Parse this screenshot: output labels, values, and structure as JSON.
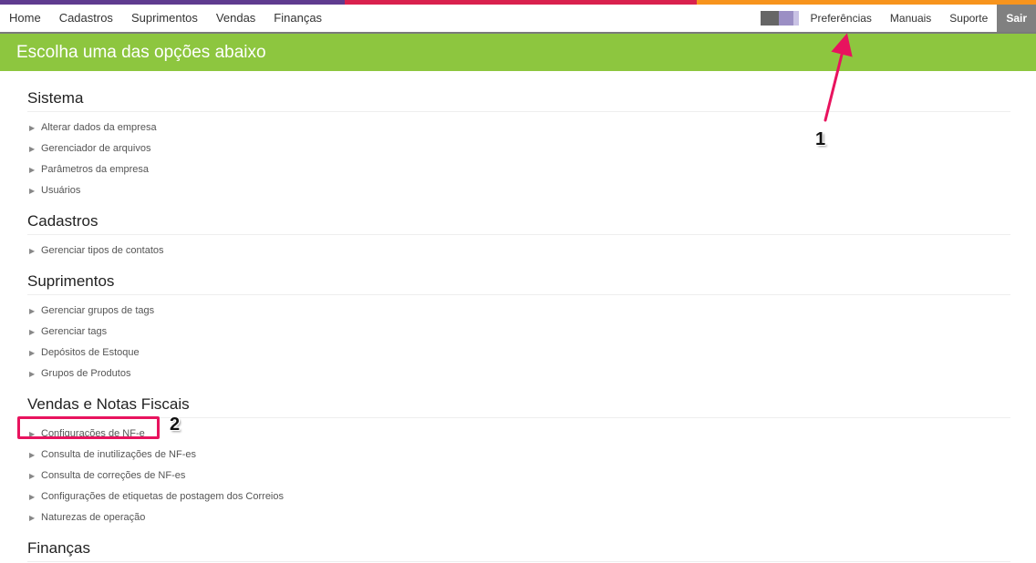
{
  "colors": {
    "stripe": [
      "#5f3b8f",
      "#d9214e",
      "#f7941d"
    ],
    "banner": "#8dc63f",
    "annotation": "#e8135e",
    "swatch": [
      "#666666",
      "#9b8fc4",
      "#c9c2e4"
    ]
  },
  "nav": {
    "left": [
      "Home",
      "Cadastros",
      "Suprimentos",
      "Vendas",
      "Finanças"
    ],
    "right": [
      "Preferências",
      "Manuais",
      "Suporte"
    ],
    "logout": "Sair"
  },
  "banner": {
    "title": "Escolha uma das opções abaixo"
  },
  "sections": [
    {
      "title": "Sistema",
      "items": [
        "Alterar dados da empresa",
        "Gerenciador de arquivos",
        "Parâmetros da empresa",
        "Usuários"
      ]
    },
    {
      "title": "Cadastros",
      "items": [
        "Gerenciar tipos de contatos"
      ]
    },
    {
      "title": "Suprimentos",
      "items": [
        "Gerenciar grupos de tags",
        "Gerenciar tags",
        "Depósitos de Estoque",
        "Grupos de Produtos"
      ]
    },
    {
      "title": "Vendas e Notas Fiscais",
      "items": [
        "Configurações de NF-e",
        "Consulta de inutilizações de NF-es",
        "Consulta de correções de NF-es",
        "Configurações de etiquetas de postagem dos Correios",
        "Naturezas de operação"
      ]
    },
    {
      "title": "Finanças",
      "items": []
    }
  ],
  "annotations": {
    "step1": "1",
    "step2": "2"
  }
}
